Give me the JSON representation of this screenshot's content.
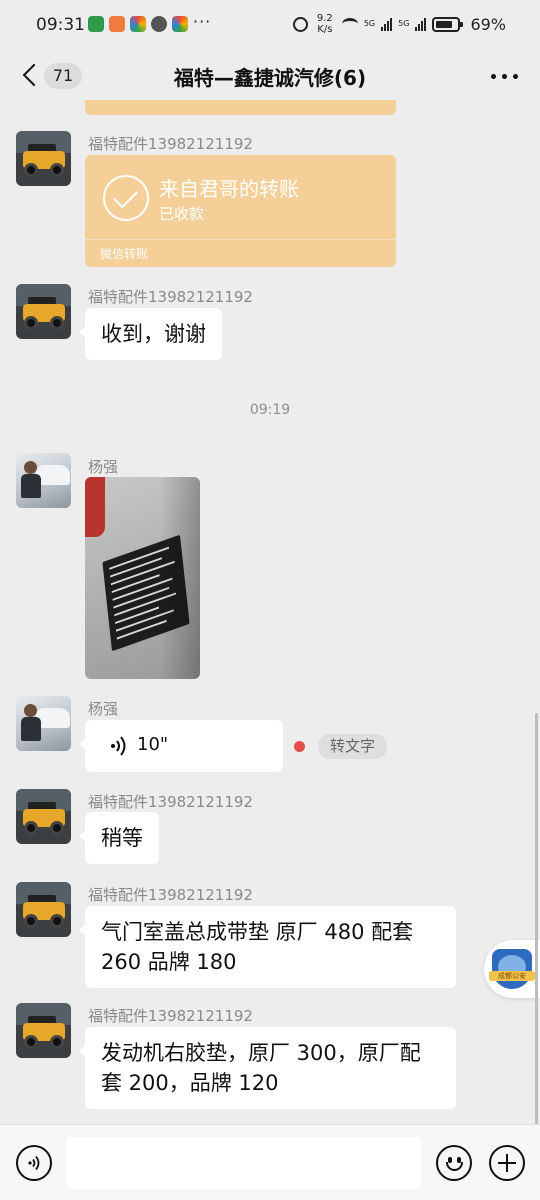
{
  "status_bar": {
    "time": "09:31",
    "more": "···",
    "speed_value": "9.2",
    "speed_unit": "K/s",
    "net1": "5G",
    "net2": "5G",
    "battery": "69%"
  },
  "header": {
    "unread_count": "71",
    "title": "福特—鑫捷诚汽修(6)"
  },
  "messages": [
    {
      "sender": "福特配件13982121192",
      "type": "transfer",
      "title": "来自君哥的转账",
      "status": "已收款",
      "footer": "微信转账"
    },
    {
      "sender": "福特配件13982121192",
      "type": "text",
      "text": "收到，谢谢"
    },
    {
      "type": "timestamp",
      "text": "09:19"
    },
    {
      "sender": "杨强",
      "type": "image"
    },
    {
      "sender": "杨强",
      "type": "voice",
      "duration": "10\"",
      "to_text_label": "转文字"
    },
    {
      "sender": "福特配件13982121192",
      "type": "text",
      "text": "稍等"
    },
    {
      "sender": "福特配件13982121192",
      "type": "text",
      "lines": [
        "气门室盖总成带垫 原厂 480 配套",
        "260 品牌 180"
      ]
    },
    {
      "sender": "福特配件13982121192",
      "type": "text",
      "lines": [
        "发动机右胶垫，原厂 300，原厂配",
        "套 200，品牌 120"
      ]
    }
  ],
  "floating_badge": {
    "label": "成都公安"
  },
  "input_bar": {
    "value": ""
  },
  "colors": {
    "background": "#ededed",
    "transfer": "#f5cf98",
    "bubble": "#ffffff",
    "unread_dot": "#e5504a"
  }
}
